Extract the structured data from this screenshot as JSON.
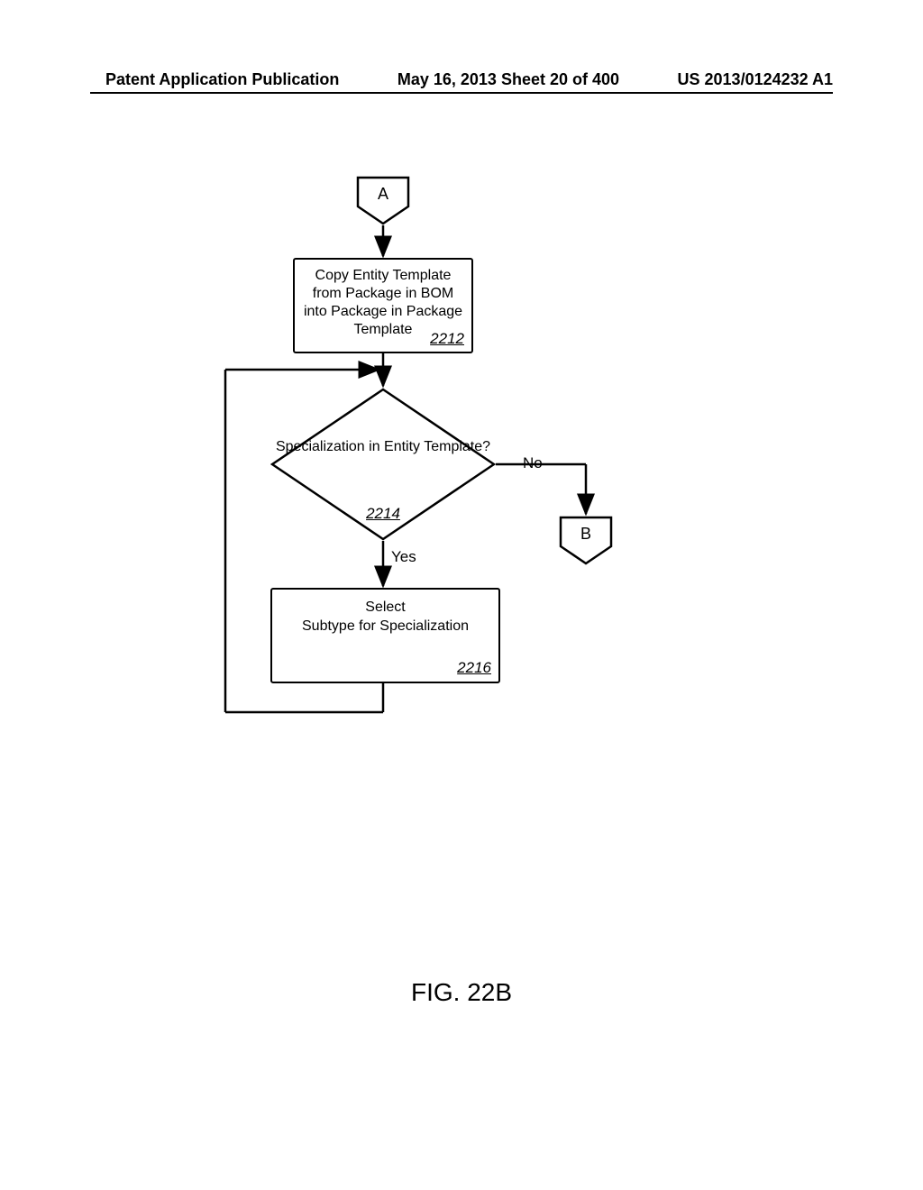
{
  "header": {
    "left": "Patent Application Publication",
    "center": "May 16, 2013  Sheet 20 of 400",
    "right": "US 2013/0124232 A1"
  },
  "flowchart": {
    "connectorA": "A",
    "step2212": {
      "text": "Copy Entity Template from Package in BOM into Package in Package Template",
      "ref": "2212"
    },
    "decision2214": {
      "text": "Specialization in Entity Template?",
      "ref": "2214",
      "yes": "Yes",
      "no": "No"
    },
    "connectorB": "B",
    "step2216": {
      "line1": "Select",
      "line2": "Subtype for Specialization",
      "ref": "2216"
    }
  },
  "figure_label": "FIG. 22B"
}
